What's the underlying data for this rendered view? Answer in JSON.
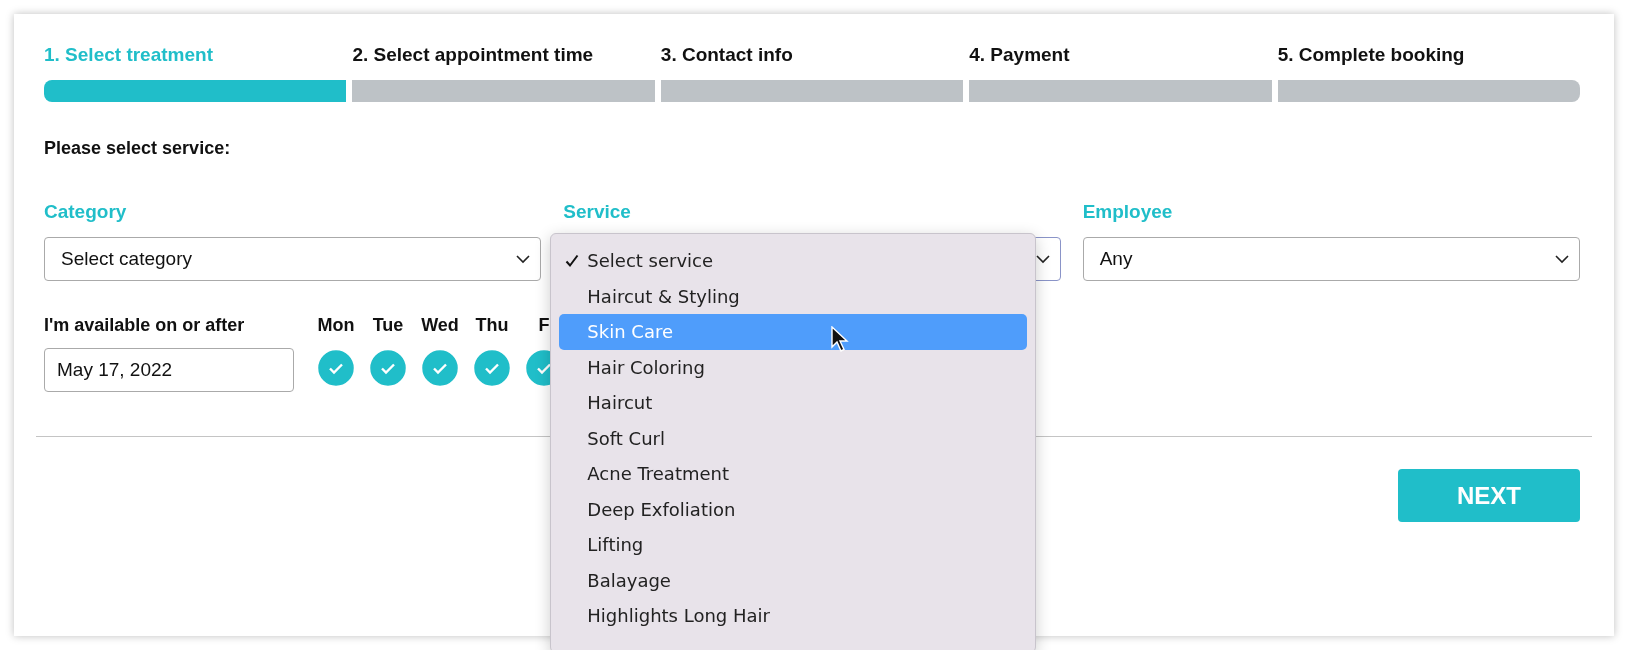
{
  "steps": [
    {
      "label": "1. Select treatment",
      "selected": true
    },
    {
      "label": "2. Select appointment time",
      "selected": false
    },
    {
      "label": "3. Contact info",
      "selected": false
    },
    {
      "label": "4. Payment",
      "selected": false
    },
    {
      "label": "5. Complete booking",
      "selected": false
    }
  ],
  "heading": "Please select service:",
  "fields": [
    {
      "label": "Category",
      "value": "Select category",
      "open": false
    },
    {
      "label": "Service",
      "open": true
    },
    {
      "label": "Employee",
      "value": "Any",
      "open": false
    }
  ],
  "dropdown": [
    {
      "label": "Select service",
      "checked": true,
      "highlighted": false
    },
    {
      "label": "Haircut & Styling",
      "checked": false,
      "highlighted": false
    },
    {
      "label": "Skin Care",
      "checked": false,
      "highlighted": true
    },
    {
      "label": "Hair Coloring",
      "checked": false,
      "highlighted": false
    },
    {
      "label": "Haircut",
      "checked": false,
      "highlighted": false
    },
    {
      "label": "Soft Curl",
      "checked": false,
      "highlighted": false
    },
    {
      "label": "Acne Treatment",
      "checked": false,
      "highlighted": false
    },
    {
      "label": "Deep Exfoliation",
      "checked": false,
      "highlighted": false
    },
    {
      "label": "Lifting",
      "checked": false,
      "highlighted": false
    },
    {
      "label": "Balayage",
      "checked": false,
      "highlighted": false
    },
    {
      "label": "Highlights Long Hair",
      "checked": false,
      "highlighted": false
    }
  ],
  "availability": {
    "label": "I'm available on or after",
    "date": "May 17, 2022"
  },
  "days": [
    {
      "label": "Mon",
      "checked": true
    },
    {
      "label": "Tue",
      "checked": true
    },
    {
      "label": "Wed",
      "checked": true
    },
    {
      "label": "Thu",
      "checked": true
    },
    {
      "label": "F",
      "checked": true
    }
  ],
  "next_button": "NEXT"
}
